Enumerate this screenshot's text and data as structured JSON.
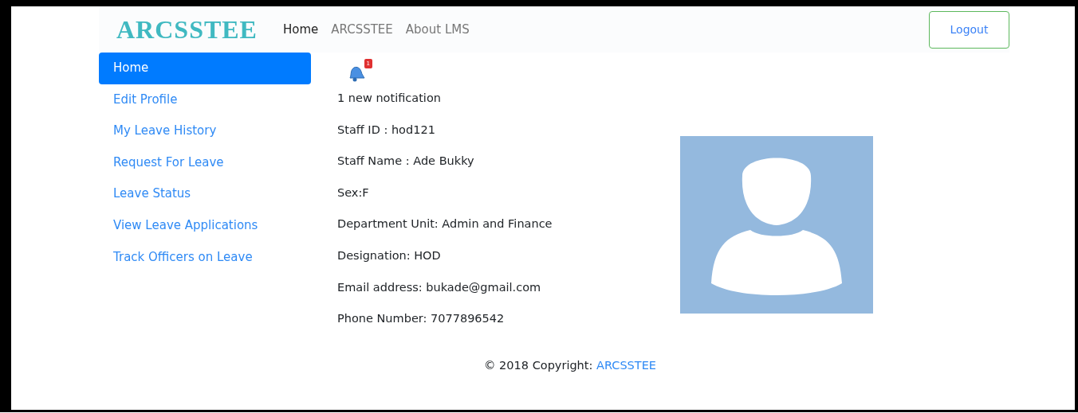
{
  "navbar": {
    "brand": "ARCSSTEE",
    "links": [
      {
        "label": "Home",
        "selected": true
      },
      {
        "label": "ARCSSTEE",
        "selected": false
      },
      {
        "label": "About LMS",
        "selected": false
      }
    ],
    "logout": "Logout"
  },
  "sidebar": {
    "items": [
      {
        "label": "Home",
        "selected": true
      },
      {
        "label": "Edit Profile",
        "selected": false
      },
      {
        "label": "My Leave History",
        "selected": false
      },
      {
        "label": "Request For Leave",
        "selected": false
      },
      {
        "label": "Leave Status",
        "selected": false
      },
      {
        "label": "View Leave Applications",
        "selected": false
      },
      {
        "label": "Track Officers on Leave",
        "selected": false
      }
    ]
  },
  "notification": {
    "badge": "1",
    "text": "1 new notification"
  },
  "profile": [
    "Staff ID : hod121",
    "Staff Name : Ade Bukky",
    "Sex:F",
    "Department Unit: Admin and Finance",
    "Designation: HOD",
    "Email address: bukade@gmail.com",
    "Phone Number: 7077896542"
  ],
  "footer": {
    "text": "© 2018 Copyright: ",
    "link": "ARCSSTEE"
  }
}
